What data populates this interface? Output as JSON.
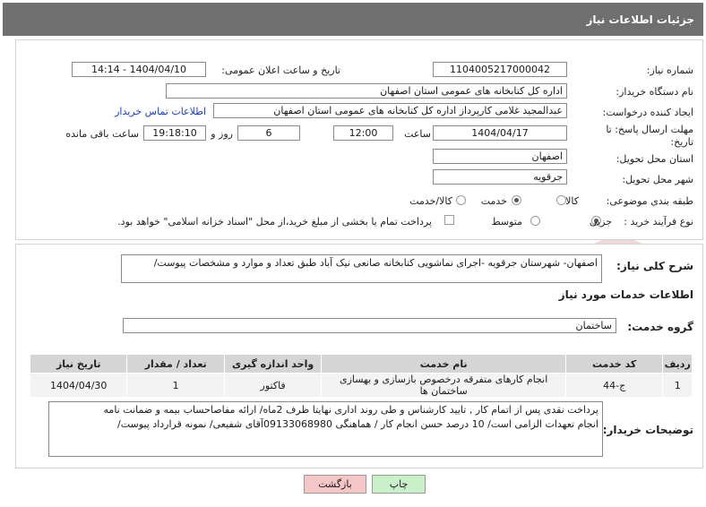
{
  "header": {
    "title": "جزئیات اطلاعات نیاز"
  },
  "form": {
    "need_number_label": "شماره نیاز:",
    "need_number": "1104005217000042",
    "announce_label": "تاریخ و ساعت اعلان عمومی:",
    "announce_value": "1404/04/10 - 14:14",
    "buyer_org_label": "نام دستگاه خریدار:",
    "buyer_org": "اداره کل کتابخانه های عمومی استان اصفهان",
    "requester_label": "ایجاد کننده درخواست:",
    "requester": "عبدالمجید غلامی کارپرداز اداره کل کتابخانه های عمومی استان اصفهان",
    "contact_link": "اطلاعات تماس خریدار",
    "deadline_label_1": "مهلت ارسال پاسخ: تا",
    "deadline_label_2": "تاریخ:",
    "deadline_date": "1404/04/17",
    "time_label": "ساعت",
    "deadline_time": "12:00",
    "days_value": "6",
    "days_label": "روز و",
    "remaining_time": "19:18:10",
    "remaining_label": "ساعت باقی مانده",
    "province_label": "استان محل تحویل:",
    "province": "اصفهان",
    "city_label": "شهر محل تحویل:",
    "city": "جرقویه",
    "category_label": "طبقه بندی موضوعی:",
    "category_options": [
      "کالا",
      "خدمت",
      "کالا/خدمت"
    ],
    "category_selected": "خدمت",
    "process_label": "نوع فرآیند خرید :",
    "process_options": [
      "جزیی",
      "متوسط"
    ],
    "process_selected": "جزیی",
    "treasury_note": "پرداخت تمام یا بخشی از مبلغ خرید،از محل \"اسناد خزانه اسلامی\" خواهد بود."
  },
  "details": {
    "summary_label": "شرح کلی نیاز:",
    "summary": "اصفهان- شهرستان جرقویه -اجرای نماشویی کتابخانه صانعی نیک آباد طبق تعداد و موارد و مشخصات پیوست/",
    "services_heading": "اطلاعات خدمات مورد نیاز",
    "service_group_label": "گروه خدمت:",
    "service_group": "ساختمان",
    "table": {
      "headers": [
        "ردیف",
        "کد خدمت",
        "نام خدمت",
        "واحد اندازه گیری",
        "تعداد / مقدار",
        "تاریخ نیاز"
      ],
      "rows": [
        [
          "1",
          "ج-44",
          "انجام کارهای متفرقه درخصوص بازسازی و بهسازی ساختمان ها",
          "فاکتور",
          "1",
          "1404/04/30"
        ]
      ]
    },
    "buyer_notes_label": "توضیحات خریدار:",
    "buyer_notes_line1": "پرداخت نقدی پس از اتمام کار , تایید کارشناس و طی روند اداری نهایتا ظرف 2ماه/ ارائه مفاصاحساب بیمه و ضمانت نامه",
    "buyer_notes_line2": "انجام تعهدات الزامی است/ 10 درصد حسن انجام کار /  هماهنگی 09133068980آقای شفیعی/ نمونه قرارداد پیوست/"
  },
  "buttons": {
    "print": "چاپ",
    "back": "بازگشت"
  },
  "colors": {
    "header_bg": "#6f6f6f",
    "back_btn": "#f4c6c6",
    "print_btn": "#c9f0c9",
    "link": "#1c3fc7"
  }
}
